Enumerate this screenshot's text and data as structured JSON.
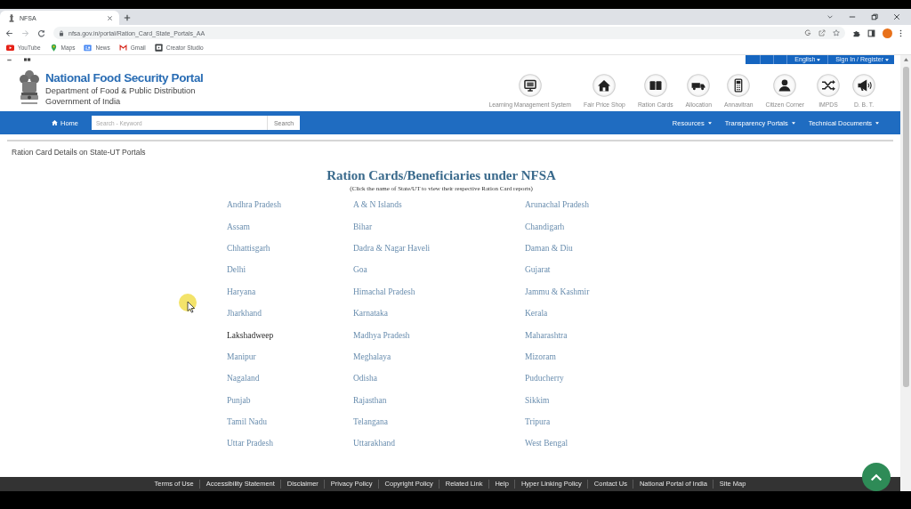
{
  "browser": {
    "tabs": [
      {
        "title": "NFSA",
        "selected": true
      }
    ],
    "nav_buttons": [
      {
        "kind": "back",
        "disabled": false
      },
      {
        "kind": "forward",
        "disabled": true
      },
      {
        "kind": "reload",
        "disabled": false
      }
    ],
    "url": "nfsa.gov.in/portal/Ration_Card_State_Portals_AA",
    "bookmarks": [
      {
        "kind": "video",
        "label": "YouTube"
      },
      {
        "kind": "pin",
        "label": "Maps"
      },
      {
        "kind": "news",
        "label": "News"
      },
      {
        "kind": "mail",
        "label": "Gmail"
      },
      {
        "kind": "studio",
        "label": "Creator Studio"
      }
    ]
  },
  "utility_bar": {
    "links": [
      "English",
      "Sign In / Register"
    ]
  },
  "header": {
    "title": "National Food Security Portal",
    "department": "Department of Food & Public Distribution",
    "government": "Government of India",
    "quick_links": [
      {
        "kind": "monitor",
        "label": "Learning Management System"
      },
      {
        "kind": "house",
        "label": "Fair Price Shop"
      },
      {
        "kind": "book",
        "label": "Ration Cards"
      },
      {
        "kind": "truck",
        "label": "Allocation"
      },
      {
        "kind": "terminal",
        "label": "Annavitran"
      },
      {
        "kind": "person",
        "label": "Citizen Corner"
      },
      {
        "kind": "shuffle",
        "label": "IMPDS"
      },
      {
        "kind": "megaphone",
        "label": "D. B. T."
      }
    ]
  },
  "nav": {
    "home": "Home",
    "search": {
      "placeholder": "Search - Keyword",
      "button": "Search"
    },
    "menus": [
      "Resources",
      "Transparency Portals",
      "Technical Documents"
    ]
  },
  "breadcrumb": "Ration Card Details on State-UT Portals",
  "section": {
    "title": "Ration Cards/Beneficiaries under NFSA",
    "note": "(Click the name of State/UT to view their respective Ration Card reports)",
    "states": [
      {
        "name": "Andhra Pradesh",
        "visited": false
      },
      {
        "name": "A & N Islands",
        "visited": false
      },
      {
        "name": "Arunachal Pradesh",
        "visited": false
      },
      {
        "name": "Assam",
        "visited": false
      },
      {
        "name": "Bihar",
        "visited": false
      },
      {
        "name": "Chandigarh",
        "visited": false
      },
      {
        "name": "Chhattisgarh",
        "visited": false
      },
      {
        "name": "Dadra & Nagar Haveli",
        "visited": false
      },
      {
        "name": "Daman & Diu",
        "visited": false
      },
      {
        "name": "Delhi",
        "visited": false
      },
      {
        "name": "Goa",
        "visited": false
      },
      {
        "name": "Gujarat",
        "visited": false
      },
      {
        "name": "Haryana",
        "visited": false
      },
      {
        "name": "Himachal Pradesh",
        "visited": false
      },
      {
        "name": "Jammu & Kashmir",
        "visited": false
      },
      {
        "name": "Jharkhand",
        "visited": false
      },
      {
        "name": "Karnataka",
        "visited": false
      },
      {
        "name": "Kerala",
        "visited": false
      },
      {
        "name": "Lakshadweep",
        "visited": true
      },
      {
        "name": "Madhya Pradesh",
        "visited": false
      },
      {
        "name": "Maharashtra",
        "visited": false
      },
      {
        "name": "Manipur",
        "visited": false
      },
      {
        "name": "Meghalaya",
        "visited": false
      },
      {
        "name": "Mizoram",
        "visited": false
      },
      {
        "name": "Nagaland",
        "visited": false
      },
      {
        "name": "Odisha",
        "visited": false
      },
      {
        "name": "Puducherry",
        "visited": false
      },
      {
        "name": "Punjab",
        "visited": false
      },
      {
        "name": "Rajasthan",
        "visited": false
      },
      {
        "name": "Sikkim",
        "visited": false
      },
      {
        "name": "Tamil Nadu",
        "visited": false
      },
      {
        "name": "Telangana",
        "visited": false
      },
      {
        "name": "Tripura",
        "visited": false
      },
      {
        "name": "Uttar Pradesh",
        "visited": false
      },
      {
        "name": "Uttarakhand",
        "visited": false
      },
      {
        "name": "West Bengal",
        "visited": false
      }
    ]
  },
  "footer": {
    "links": [
      "Terms of Use",
      "Accessibility Statement",
      "Disclaimer",
      "Privacy Policy",
      "Copyright Policy",
      "Related Link",
      "Help",
      "Hyper Linking Policy",
      "Contact Us",
      "National Portal of India",
      "Site Map"
    ]
  }
}
